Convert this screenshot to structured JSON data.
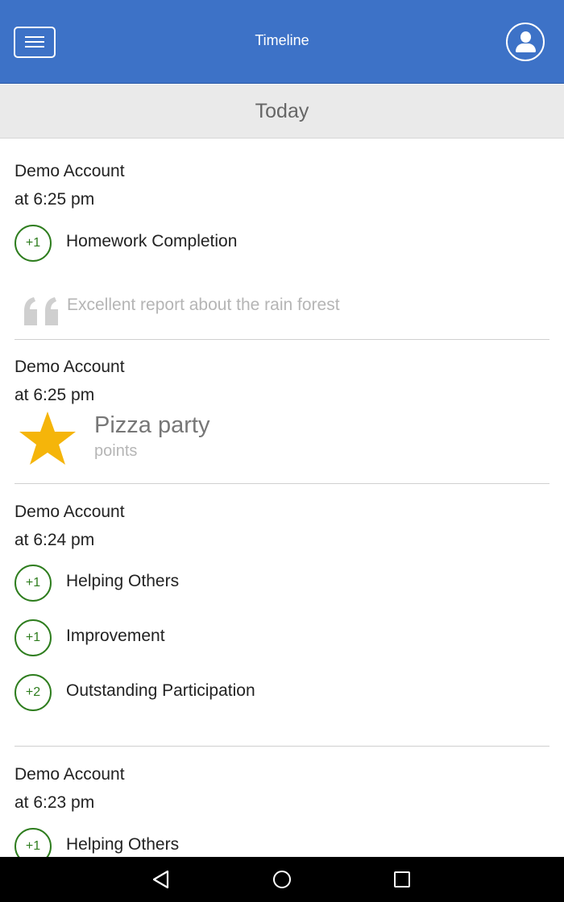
{
  "app_bar": {
    "title": "Timeline",
    "menu_icon": "hamburger-menu-icon",
    "profile_icon": "user-icon"
  },
  "section": {
    "label": "Today"
  },
  "entries": [
    {
      "name": "Demo Account",
      "time": "at 6:25 pm",
      "behaviors": [
        {
          "points": "+1",
          "label": "Homework Completion"
        }
      ],
      "comment": "Excellent report about the rain forest"
    },
    {
      "name": "Demo Account",
      "time": "at 6:25 pm",
      "reward": {
        "title": "Pizza party",
        "subtitle": "points",
        "icon": "star-icon"
      }
    },
    {
      "name": "Demo Account",
      "time": "at 6:24 pm",
      "behaviors": [
        {
          "points": "+1",
          "label": "Helping Others"
        },
        {
          "points": "+1",
          "label": "Improvement"
        },
        {
          "points": "+2",
          "label": "Outstanding Participation"
        }
      ]
    },
    {
      "name": "Demo Account",
      "time": "at 6:23 pm",
      "behaviors": [
        {
          "points": "+1",
          "label": "Helping Others"
        }
      ]
    }
  ],
  "nav": {
    "back_icon": "back-triangle-icon",
    "home_icon": "home-circle-icon",
    "recent_icon": "recent-apps-square-icon"
  },
  "colors": {
    "app_bar": "#3d72c7",
    "badge_green": "#2e7d1e",
    "star": "#f5b50a"
  }
}
